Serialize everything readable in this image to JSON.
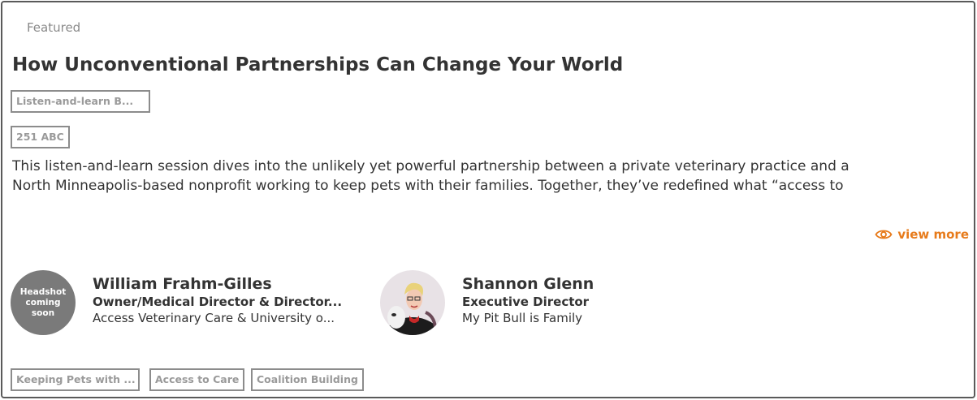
{
  "session": {
    "featured_label": "Featured",
    "title": "How Unconventional Partnerships Can Change Your World",
    "format_tag": "Listen-and-learn B...",
    "room_tag": "251 ABC",
    "description_line1": "This listen-and-learn session dives into the unlikely yet powerful partnership between a private veterinary practice and a",
    "description_line2": "North Minneapolis-based nonprofit working to keep pets with their families. Together, they’ve redefined what “access to",
    "view_more_label": "view more"
  },
  "speakers": [
    {
      "avatar_text": "Headshot coming soon",
      "name": "William Frahm-Gilles",
      "role": "Owner/Medical Director & Director...",
      "org": "Access Veterinary Care & University o..."
    },
    {
      "name": "Shannon Glenn",
      "role": "Executive Director",
      "org": "My Pit Bull is Family"
    }
  ],
  "topic_tags": [
    "Keeping Pets with ...",
    "Access to Care",
    "Coalition Building"
  ],
  "colors": {
    "accent": "#e77b1b",
    "border": "#5a5a5a",
    "tag_border": "#8c8c8c",
    "tag_text": "#9a9a9a",
    "placeholder_avatar": "#7a7a7a"
  }
}
